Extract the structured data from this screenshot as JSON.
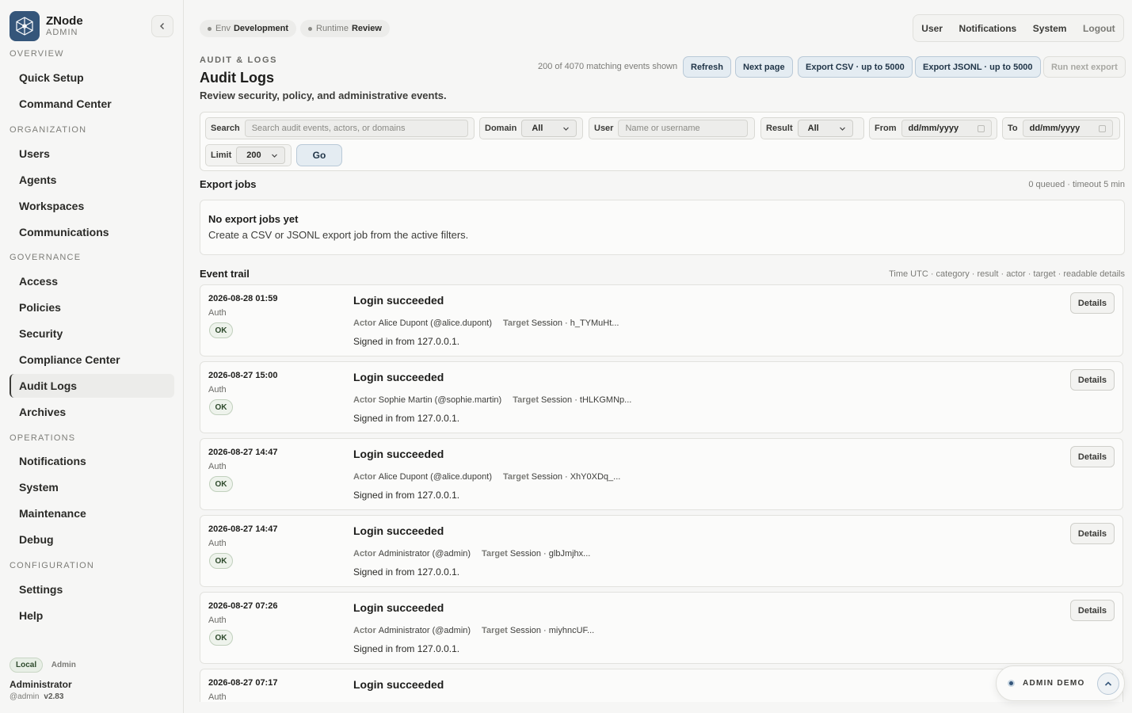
{
  "brand": {
    "name": "ZNode",
    "sub": "ADMIN"
  },
  "nav": {
    "sections": [
      {
        "label": "OVERVIEW",
        "items": [
          "Quick Setup",
          "Command Center"
        ]
      },
      {
        "label": "ORGANIZATION",
        "items": [
          "Users",
          "Agents",
          "Workspaces",
          "Communications"
        ]
      },
      {
        "label": "GOVERNANCE",
        "items": [
          "Access",
          "Policies",
          "Security",
          "Compliance Center",
          "Audit Logs",
          "Archives"
        ]
      },
      {
        "label": "OPERATIONS",
        "items": [
          "Notifications",
          "System",
          "Maintenance",
          "Debug"
        ]
      },
      {
        "label": "CONFIGURATION",
        "items": [
          "Settings",
          "Help"
        ]
      }
    ],
    "active": "Audit Logs"
  },
  "footer": {
    "badge_local": "Local",
    "badge_admin": "Admin",
    "user": "Administrator",
    "handle": "@admin",
    "version": "v2.83"
  },
  "topbar": {
    "env_key": "Env",
    "env_val": "Development",
    "runtime_key": "Runtime",
    "runtime_val": "Review",
    "links": [
      "User",
      "Notifications",
      "System",
      "Logout"
    ]
  },
  "header": {
    "eyebrow": "AUDIT & LOGS",
    "title": "Audit Logs",
    "subtitle": "Review security, policy, and administrative events.",
    "match": "200 of 4070 matching events shown",
    "buttons": [
      "Refresh",
      "Next page",
      "Export CSV · up to 5000",
      "Export JSONL · up to 5000",
      "Run next export"
    ]
  },
  "filters": {
    "search_label": "Search",
    "search_placeholder": "Search audit events, actors, or domains",
    "domain_label": "Domain",
    "domain_value": "All",
    "user_label": "User",
    "user_placeholder": "Name or username",
    "result_label": "Result",
    "result_value": "All",
    "from_label": "From",
    "from_value": "dd/mm/yyyy",
    "to_label": "To",
    "to_value": "dd/mm/yyyy",
    "limit_label": "Limit",
    "limit_value": "200",
    "go": "Go"
  },
  "export_jobs": {
    "title": "Export jobs",
    "meta": "0 queued · timeout 5 min",
    "empty_title": "No export jobs yet",
    "empty_text": "Create a CSV or JSONL export job from the active filters."
  },
  "event_trail": {
    "title": "Event trail",
    "meta": "Time UTC · category · result · actor · target · readable details",
    "actor_label": "Actor",
    "target_label": "Target",
    "details_label": "Details",
    "events": [
      {
        "time": "2026-08-28 01:59",
        "category": "Auth",
        "result": "OK",
        "title": "Login succeeded",
        "actor": "Alice Dupont (@alice.dupont)",
        "target": "Session · h_TYMuHt...",
        "detail": "Signed in from 127.0.0.1."
      },
      {
        "time": "2026-08-27 15:00",
        "category": "Auth",
        "result": "OK",
        "title": "Login succeeded",
        "actor": "Sophie Martin (@sophie.martin)",
        "target": "Session · tHLKGMNp...",
        "detail": "Signed in from 127.0.0.1."
      },
      {
        "time": "2026-08-27 14:47",
        "category": "Auth",
        "result": "OK",
        "title": "Login succeeded",
        "actor": "Alice Dupont (@alice.dupont)",
        "target": "Session · XhY0XDq_...",
        "detail": "Signed in from 127.0.0.1."
      },
      {
        "time": "2026-08-27 14:47",
        "category": "Auth",
        "result": "OK",
        "title": "Login succeeded",
        "actor": "Administrator (@admin)",
        "target": "Session · glbJmjhx...",
        "detail": "Signed in from 127.0.0.1."
      },
      {
        "time": "2026-08-27 07:26",
        "category": "Auth",
        "result": "OK",
        "title": "Login succeeded",
        "actor": "Administrator (@admin)",
        "target": "Session · miyhncUF...",
        "detail": "Signed in from 127.0.0.1."
      },
      {
        "time": "2026-08-27 07:17",
        "category": "Auth",
        "result": "",
        "title": "Login succeeded",
        "actor": "",
        "target": "",
        "detail": ""
      }
    ]
  },
  "demo": {
    "label": "ADMIN DEMO"
  },
  "colors": {
    "accent": "#35567a",
    "ok": "#2e4a2c",
    "button_bg": "#e4ecf2"
  },
  "icons": {
    "logo": "network-hexagon-icon",
    "collapse": "chevron-left-icon",
    "calendar": "calendar-icon",
    "chevron": "chevron-down-icon",
    "up": "chevron-up-icon"
  }
}
